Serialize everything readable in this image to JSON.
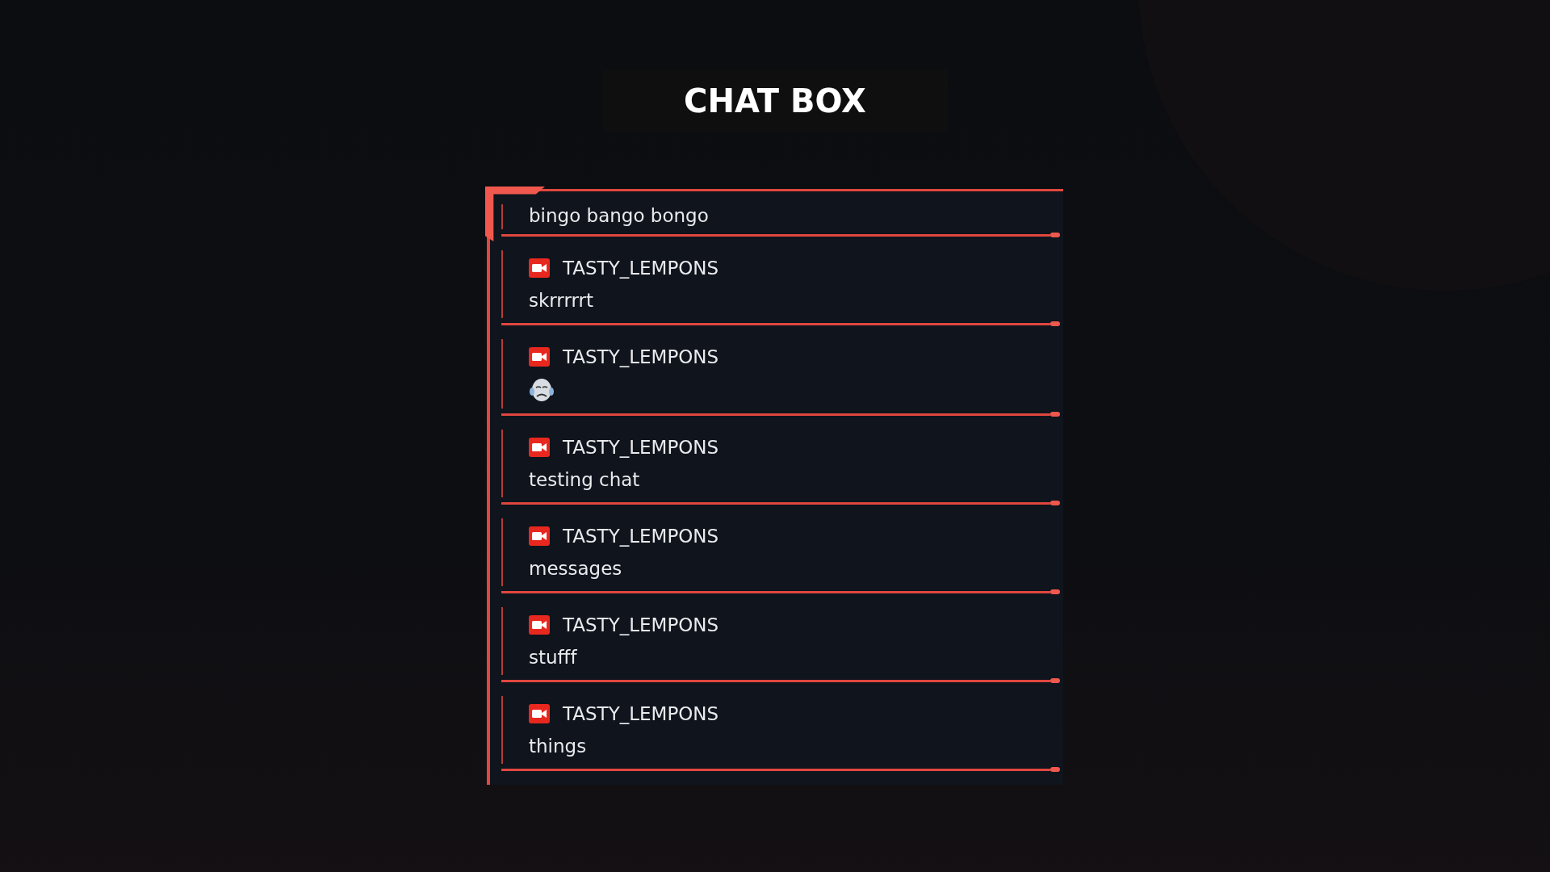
{
  "title": "CHAT BOX",
  "messages": [
    {
      "kind": "plain",
      "text": "bingo bango bongo"
    },
    {
      "kind": "text",
      "username": "TASTY_LEMPONS",
      "text": "skrrrrrt"
    },
    {
      "kind": "emote",
      "username": "TASTY_LEMPONS"
    },
    {
      "kind": "text",
      "username": "TASTY_LEMPONS",
      "text": "testing chat"
    },
    {
      "kind": "text",
      "username": "TASTY_LEMPONS",
      "text": "messages"
    },
    {
      "kind": "text",
      "username": "TASTY_LEMPONS",
      "text": "stufff"
    },
    {
      "kind": "text",
      "username": "TASTY_LEMPONS",
      "text": "things"
    }
  ]
}
